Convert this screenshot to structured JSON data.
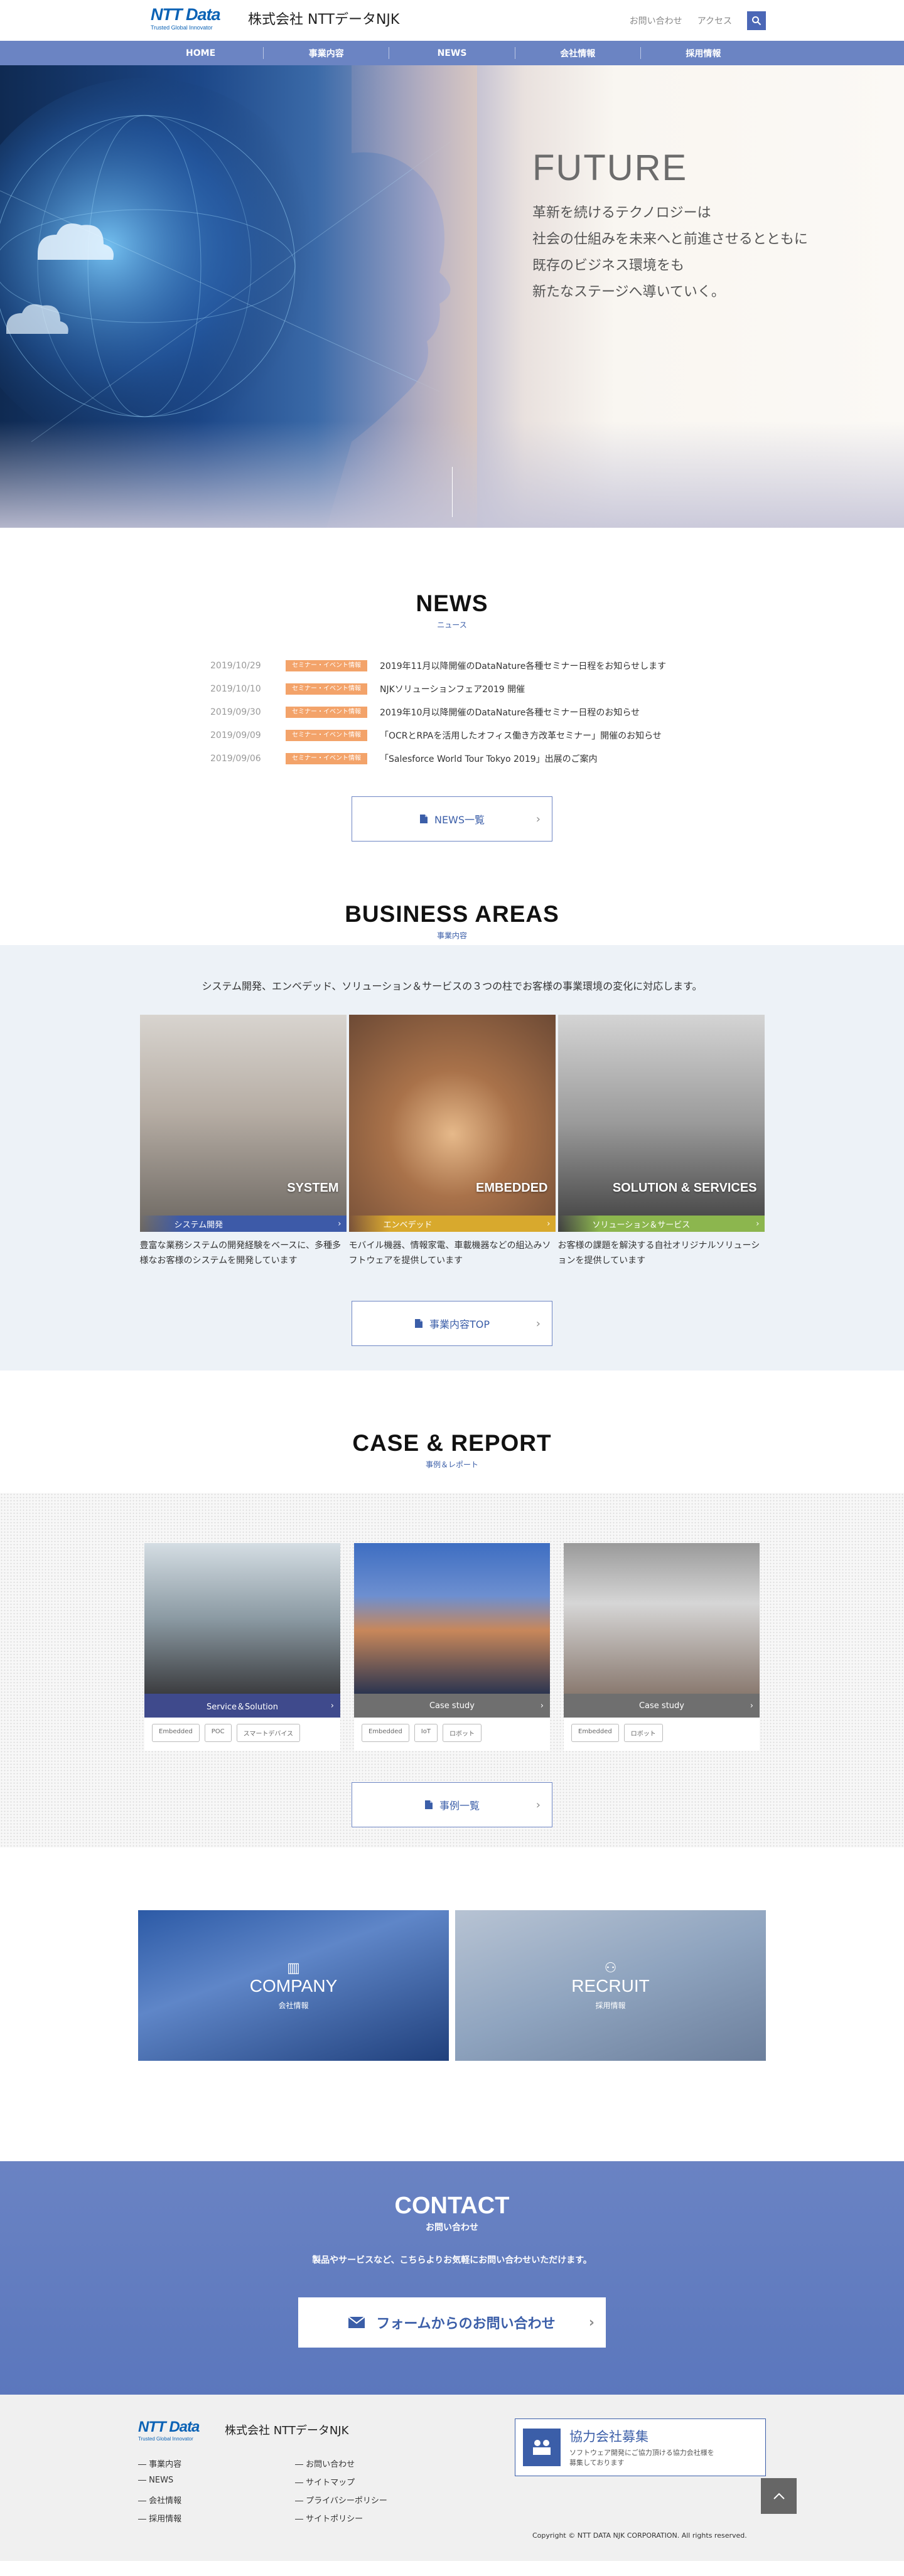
{
  "header": {
    "logo_mark": "NTT Data",
    "logo_tagline": "Trusted Global Innovator",
    "company_name": "株式会社 NTTデータNJK",
    "util_links": [
      "お問い合わせ",
      "アクセス"
    ],
    "search_icon": "search-icon"
  },
  "nav": {
    "items": [
      "HOME",
      "事業内容",
      "NEWS",
      "会社情報",
      "採用情報"
    ],
    "bg_color": "#6b84c3"
  },
  "hero": {
    "title": "FUTURE",
    "lines": [
      "革新を続けるテクノロジーは",
      "社会の仕組みを未来へと前進させるとともに",
      "既存のビジネス環境をも",
      "新たなステージへ導いていく。"
    ]
  },
  "news": {
    "title": "NEWS",
    "subtitle": "ニュース",
    "items": [
      {
        "date": "2019/10/29",
        "category": "セミナー・イベント情報",
        "title": "2019年11月以降開催のDataNature各種セミナー日程をお知らせします"
      },
      {
        "date": "2019/10/10",
        "category": "セミナー・イベント情報",
        "title": "NJKソリューションフェア2019 開催"
      },
      {
        "date": "2019/09/30",
        "category": "セミナー・イベント情報",
        "title": "2019年10月以降開催のDataNature各種セミナー日程のお知らせ"
      },
      {
        "date": "2019/09/09",
        "category": "セミナー・イベント情報",
        "title": "「OCRとRPAを活用したオフィス働き方改革セミナー」開催のお知らせ"
      },
      {
        "date": "2019/09/06",
        "category": "セミナー・イベント情報",
        "title": "「Salesforce World Tour Tokyo 2019」出展のご案内"
      }
    ],
    "more_label": "NEWS一覧",
    "category_color": "#f3a36a"
  },
  "business": {
    "title": "BUSINESS AREAS",
    "subtitle": "事業内容",
    "lead": "システム開発、エンベデッド、ソリューション＆サービスの３つの柱でお客様の事業環境の変化に対応します。",
    "cards": [
      {
        "big_label": "SYSTEM",
        "bar_label": "システム開発",
        "bar_color": "#3d5aa8",
        "desc": "豊富な業務システムの開発経験をベースに、多種多様なお客様のシステムを開発しています"
      },
      {
        "big_label": "EMBEDDED",
        "bar_label": "エンベデッド",
        "bar_color": "#d8a92d",
        "desc": "モバイル機器、情報家電、車載機器などの組込みソフトウェアを提供しています"
      },
      {
        "big_label": "SOLUTION & SERVICES",
        "bar_label": "ソリューション＆サービス",
        "bar_color": "#8cb64e",
        "desc": "お客様の課題を解決する自社オリジナルソリューションを提供しています"
      }
    ],
    "more_label": "事業内容TOP"
  },
  "case": {
    "title": "CASE & REPORT",
    "subtitle": "事例＆レポート",
    "cards": [
      {
        "bar_label": "Service＆Solution",
        "bar_color": "#3f4a8c",
        "tags": [
          "Embedded",
          "POC",
          "スマートデバイス"
        ]
      },
      {
        "bar_label": "Case study",
        "bar_color": "#6f6f6f",
        "tags": [
          "Embedded",
          "IoT",
          "ロボット"
        ]
      },
      {
        "bar_label": "Case study",
        "bar_color": "#6f6f6f",
        "tags": [
          "Embedded",
          "ロボット"
        ]
      }
    ],
    "more_label": "事例一覧"
  },
  "company_recruit": {
    "company": {
      "en": "COMPANY",
      "ja": "会社情報"
    },
    "recruit": {
      "en": "RECRUIT",
      "ja": "採用情報"
    }
  },
  "contact": {
    "title": "CONTACT",
    "subtitle": "お問い合わせ",
    "lead": "製品やサービスなど、こちらよりお気軽にお問い合わせいただけます。",
    "button_label": "フォームからのお問い合わせ"
  },
  "footer": {
    "logo_mark": "NTT Data",
    "logo_tagline": "Trusted Global Innovator",
    "company_name": "株式会社 NTTデータNJK",
    "links_left": [
      "― 事業内容",
      "― NEWS",
      "― 会社情報",
      "― 採用情報"
    ],
    "links_right": [
      "― お問い合わせ",
      "― サイトマップ",
      "― プライバシーポリシー",
      "― サイトポリシー"
    ],
    "partner_title": "協力会社募集",
    "partner_text": [
      "ソフトウェア開発にご協力頂ける協力会社様を",
      "募集しております"
    ],
    "copyright": "Copyright © NTT DATA NJK CORPORATION. All rights reserved."
  }
}
